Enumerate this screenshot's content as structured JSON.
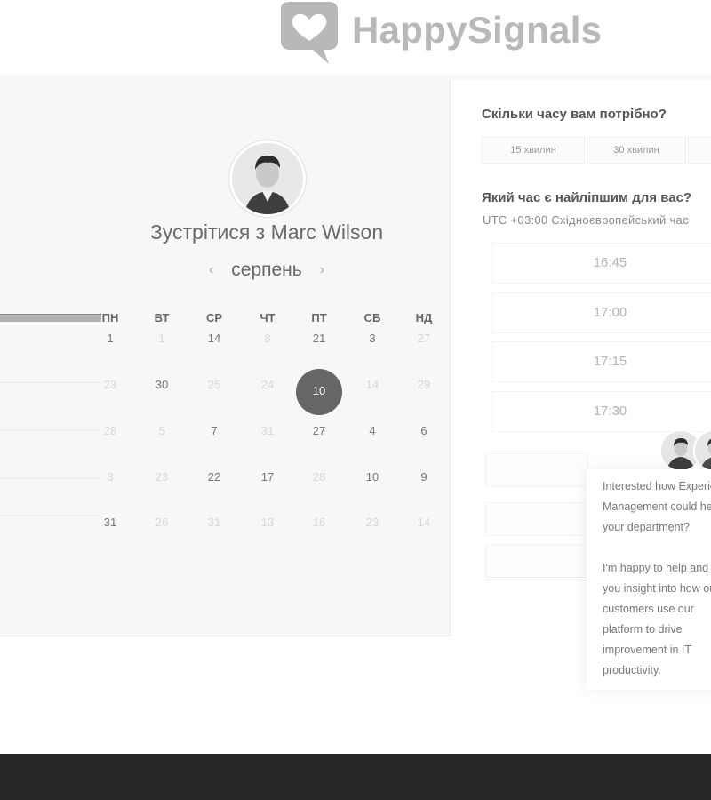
{
  "brand": {
    "name": "HappySignals",
    "color": "#b8b8b8"
  },
  "calendar": {
    "title": "Зустрітися з Marc Wilson",
    "month": "серпень",
    "prev_icon": "‹",
    "next_icon": "›",
    "weekdays": [
      "ПН",
      "ВТ",
      "СР",
      "ЧТ",
      "ПТ",
      "СБ",
      "НД"
    ],
    "weeks": [
      [
        {
          "t": "1",
          "dim": false
        },
        {
          "t": "1",
          "dim": true
        },
        {
          "t": "14",
          "dim": false
        },
        {
          "t": "8",
          "dim": true
        },
        {
          "t": "21",
          "dim": false
        },
        {
          "t": "3",
          "dim": false
        },
        {
          "t": "27",
          "dim": true
        }
      ],
      [
        {
          "t": "23",
          "dim": true
        },
        {
          "t": "30",
          "dim": false
        },
        {
          "t": "25",
          "dim": true
        },
        {
          "t": "24",
          "dim": true
        },
        {
          "t": "10",
          "dim": false,
          "sel": true
        },
        {
          "t": "14",
          "dim": true
        },
        {
          "t": "29",
          "dim": true
        }
      ],
      [
        {
          "t": "28",
          "dim": true
        },
        {
          "t": "5",
          "dim": true
        },
        {
          "t": "7",
          "dim": false
        },
        {
          "t": "31",
          "dim": true
        },
        {
          "t": "27",
          "dim": false
        },
        {
          "t": "4",
          "dim": false
        },
        {
          "t": "6",
          "dim": false
        }
      ],
      [
        {
          "t": "3",
          "dim": true
        },
        {
          "t": "23",
          "dim": true
        },
        {
          "t": "22",
          "dim": false
        },
        {
          "t": "17",
          "dim": false
        },
        {
          "t": "28",
          "dim": true
        },
        {
          "t": "10",
          "dim": false
        },
        {
          "t": "9",
          "dim": false
        }
      ],
      [
        {
          "t": "31",
          "dim": false
        },
        {
          "t": "26",
          "dim": true
        },
        {
          "t": "31",
          "dim": true
        },
        {
          "t": "13",
          "dim": true
        },
        {
          "t": "16",
          "dim": true
        },
        {
          "t": "23",
          "dim": true
        },
        {
          "t": "14",
          "dim": true
        }
      ]
    ]
  },
  "duration": {
    "question": "Скільки часу вам потрібно?",
    "options": [
      "15 хвилин",
      "30 хвилин"
    ]
  },
  "time": {
    "question": "Який час є найліпшим для вас?",
    "timezone": "UTC +03:00 Східноєвропейський час",
    "slots": [
      "16:45",
      "17:00",
      "17:15",
      "17:30"
    ]
  },
  "chat": {
    "message1": "Interested how Experience Management could help your department?",
    "message2": "I'm happy to help and give you insight into how our customers use our platform to drive improvement in IT productivity."
  }
}
